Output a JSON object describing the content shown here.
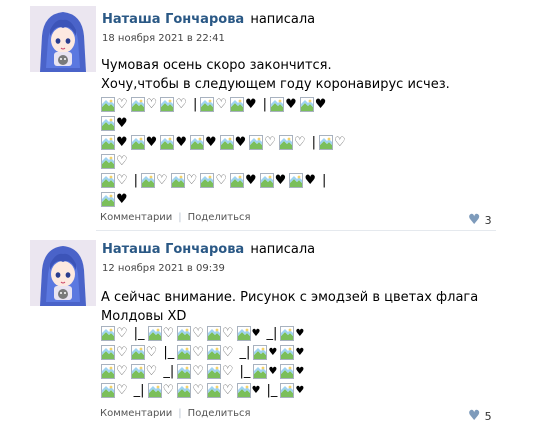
{
  "posts": [
    {
      "author": "Наташа Гончарова",
      "verb": "написала",
      "date": "18 ноября 2021 в 22:41",
      "text_lines": [
        "Чумовая осень скоро закончится.",
        "Хочу,чтобы в следующем году коронавирус исчез."
      ],
      "emoji_rows": [
        [
          "img",
          "w",
          "img",
          "w",
          "img",
          "w",
          "|",
          "img",
          "w",
          "img",
          "b",
          "|",
          "img",
          "b",
          "img",
          "b"
        ],
        [
          "img",
          "b"
        ],
        [
          "img",
          "b",
          "img",
          "b",
          "img",
          "b",
          "img",
          "b",
          "img",
          "b",
          "img",
          "w",
          "img",
          "w",
          "|",
          "img",
          "w"
        ],
        [
          "img",
          "w"
        ],
        [
          "img",
          "w",
          "|",
          "img",
          "w",
          "img",
          "w",
          "img",
          "w",
          "img",
          "b",
          "img",
          "b",
          "img",
          "b",
          "|"
        ],
        [
          "img",
          "b"
        ]
      ],
      "footer": {
        "comments": "Комментарии",
        "separator": "|",
        "share": "Поделиться"
      },
      "likes": "3"
    },
    {
      "author": "Наташа Гончарова",
      "verb": "написала",
      "date": "12 ноября 2021 в 09:39",
      "text_lines": [
        "А сейчас внимание. Рисунок с эмодзей в цветах флага",
        "Молдовы XD"
      ],
      "emoji_rows": [
        [
          "img",
          "w",
          "|_",
          "img",
          "w",
          "img",
          "w",
          "img",
          "w",
          "img",
          "sb",
          "_|",
          "img",
          "sb"
        ],
        [
          "img",
          "w",
          "img",
          "w",
          "|_",
          "img",
          "w",
          "img",
          "w",
          "_|",
          "img",
          "sb",
          "img",
          "sb"
        ],
        [
          "img",
          "w",
          "img",
          "w",
          "_|",
          "img",
          "w",
          "img",
          "w",
          "|_",
          "img",
          "sb",
          "img",
          "sb"
        ],
        [
          "img",
          "w",
          "_|",
          "img",
          "w",
          "img",
          "w",
          "img",
          "w",
          "img",
          "sb",
          "|_",
          "img",
          "sb"
        ]
      ],
      "footer": {
        "comments": "Комментарии",
        "separator": "|",
        "share": "Поделиться"
      },
      "likes": "5"
    }
  ],
  "glyphs": {
    "white_heart": "♡",
    "black_heart": "♥",
    "like_heart": "♥"
  },
  "colors": {
    "author": "#2a5885",
    "like_heart": "#7e9bbb"
  }
}
